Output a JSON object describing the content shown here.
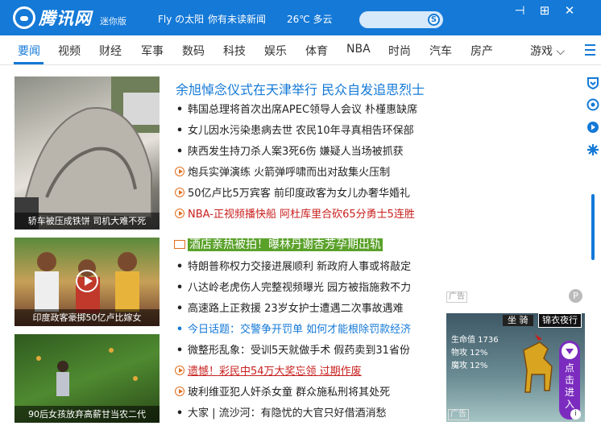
{
  "header": {
    "logo_text": "腾讯网",
    "edition": "迷你版",
    "user": "Fly の太阳",
    "unread": "你有未读新闻",
    "weather": "26℃ 多云"
  },
  "window_controls": {
    "pin": "⊣",
    "add": "⊞",
    "close": "✕"
  },
  "nav": {
    "tabs": [
      "要闻",
      "视频",
      "财经",
      "军事",
      "数码",
      "科技",
      "娱乐",
      "体育",
      "NBA",
      "时尚",
      "汽车",
      "房产"
    ],
    "more": "游戏",
    "active": "要闻"
  },
  "cards": [
    {
      "caption": "轿车被压成铁饼 司机大难不死"
    },
    {
      "caption": "印度政客豪掷50亿卢比嫁女"
    },
    {
      "caption": "90后女孩放弃高薪甘当农二代"
    }
  ],
  "headline": "余旭悼念仪式在天津举行 民众自发追思烈士",
  "news": [
    {
      "marker": "dot",
      "text": "韩国总理将首次出席APEC领导人会议 朴槿惠缺席",
      "style": "normal"
    },
    {
      "marker": "dot",
      "text": "女儿因水污染患病去世 农民10年寻真相告环保部",
      "style": "normal"
    },
    {
      "marker": "dot",
      "text": "陕西发生持刀杀人案3死6伤 嫌疑人当场被抓获",
      "style": "normal"
    },
    {
      "marker": "video",
      "text": "炮兵实弹演练 火箭弹呼啸而出对敌集火压制",
      "style": "normal"
    },
    {
      "marker": "video",
      "text": "50亿卢比5万宾客 前印度政客为女儿办奢华婚礼",
      "style": "normal"
    },
    {
      "marker": "video",
      "text": "NBA-正视频播快船 阿杜库里合砍65分勇士5连胜",
      "style": "red-plain"
    },
    {
      "marker": "image",
      "text": "酒店亲热被拍！曝林丹谢杏芳孕期出轨",
      "style": "highlight"
    },
    {
      "marker": "dot",
      "text": "特朗普称权力交接进展顺利 新政府人事或将敲定",
      "style": "normal"
    },
    {
      "marker": "dot",
      "text": "八达岭老虎伤人完整视频曝光 园方被指施救不力",
      "style": "normal"
    },
    {
      "marker": "dot",
      "text": "高速路上正救援 23岁女护士遭遇二次事故遇难",
      "style": "normal"
    },
    {
      "marker": "dot",
      "text": "今日话题：交警争开罚单 如何才能根除罚款经济",
      "style": "blue"
    },
    {
      "marker": "dot",
      "text": "微整形乱象：受训5天就做手术 假药卖到31省份",
      "style": "normal"
    },
    {
      "marker": "video",
      "text": "遗憾！彩民中54万大奖忘领 过期作废",
      "style": "red"
    },
    {
      "marker": "video",
      "text": "玻利维亚犯人奸杀女童 群众施私刑将其处死",
      "style": "normal"
    },
    {
      "marker": "dot",
      "text": "大家 | 流沙河：有隐忧的大官只好借酒消愁",
      "style": "normal"
    }
  ],
  "ad": {
    "label": "广告",
    "tag1": "坐 骑",
    "tag2": "锦衣夜行",
    "stats": [
      "生命值 1736",
      "物攻 12%",
      "魔攻 12%"
    ],
    "cta": "点击进入",
    "bottom_label": "广告"
  },
  "colors": {
    "brand_blue": "#1479d7",
    "highlight_green": "#5aa12a",
    "alert_red": "#c8201e",
    "video_orange": "#e07020"
  }
}
